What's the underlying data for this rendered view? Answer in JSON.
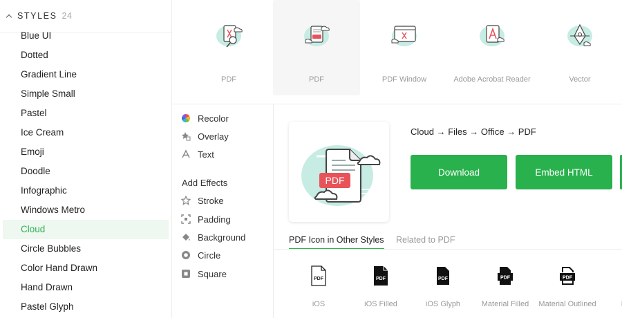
{
  "styles_panel": {
    "title": "STYLES",
    "count": "24",
    "items": [
      {
        "label": "Blue UI"
      },
      {
        "label": "Dotted"
      },
      {
        "label": "Gradient Line"
      },
      {
        "label": "Simple Small"
      },
      {
        "label": "Pastel"
      },
      {
        "label": "Ice Cream"
      },
      {
        "label": "Emoji"
      },
      {
        "label": "Doodle"
      },
      {
        "label": "Infographic"
      },
      {
        "label": "Windows Metro"
      },
      {
        "label": "Cloud",
        "active": true
      },
      {
        "label": "Circle Bubbles"
      },
      {
        "label": "Color Hand Drawn"
      },
      {
        "label": "Hand Drawn"
      },
      {
        "label": "Pastel Glyph"
      }
    ]
  },
  "icon_strip": [
    {
      "label": "PDF",
      "icon": "pdf-cloud-magnifier-icon"
    },
    {
      "label": "PDF",
      "icon": "pdf-cloud-file-icon",
      "selected": true
    },
    {
      "label": "PDF Window",
      "icon": "pdf-window-cloud-icon"
    },
    {
      "label": "Adobe Acrobat Reader",
      "icon": "adobe-acrobat-cloud-icon"
    },
    {
      "label": "Vector",
      "icon": "vector-cloud-icon"
    }
  ],
  "effects": {
    "items": [
      {
        "label": "Recolor",
        "icon": "color-wheel-icon"
      },
      {
        "label": "Overlay",
        "icon": "overlay-star-icon"
      },
      {
        "label": "Text",
        "icon": "text-a-icon"
      }
    ],
    "add_effects_title": "Add Effects",
    "add_items": [
      {
        "label": "Stroke",
        "icon": "star-outline-icon"
      },
      {
        "label": "Padding",
        "icon": "padding-icon"
      },
      {
        "label": "Background",
        "icon": "paint-bucket-icon"
      },
      {
        "label": "Circle",
        "icon": "circle-icon"
      },
      {
        "label": "Square",
        "icon": "square-icon"
      }
    ]
  },
  "preview": {
    "breadcrumb": "Cloud → Files → Office → PDF",
    "badge_text": "PDF"
  },
  "actions": {
    "download": "Download",
    "embed": "Embed HTML"
  },
  "tabs": {
    "active": "PDF Icon in Other Styles",
    "inactive": "Related to PDF"
  },
  "other_styles": [
    {
      "label": "iOS",
      "badge": "PDF"
    },
    {
      "label": "iOS Filled",
      "badge": "PDF"
    },
    {
      "label": "iOS Glyph",
      "badge": "PDF"
    },
    {
      "label": "Material Filled",
      "badge": "PDF"
    },
    {
      "label": "Material Outlined",
      "badge": "PDF"
    },
    {
      "label": "Mate",
      "badge": ""
    }
  ],
  "colors": {
    "accent": "#2fb24f",
    "button": "#28b14c",
    "cloud_mint": "#c6ece3",
    "pdf_red": "#e8535a"
  }
}
